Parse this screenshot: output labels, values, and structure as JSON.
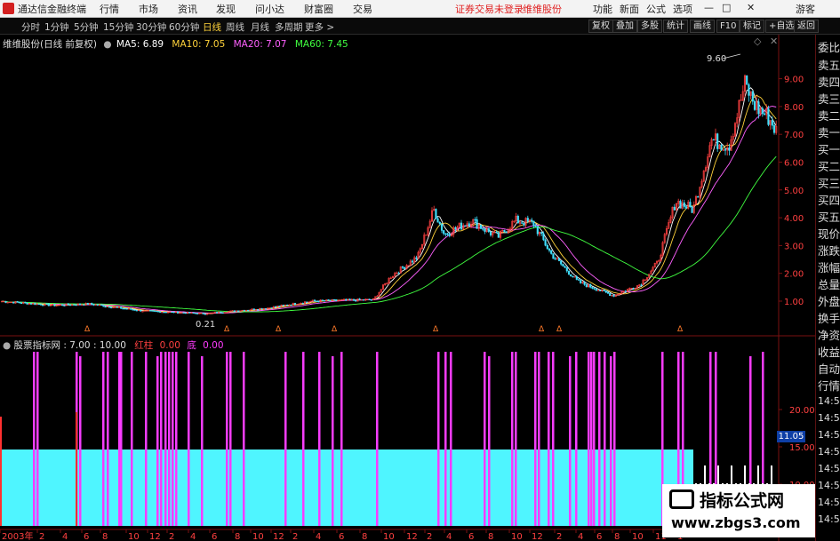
{
  "menubar": {
    "app_title": "通达信金融终端",
    "items": [
      "行情",
      "市场",
      "资讯",
      "发现",
      "问小达",
      "财富圈",
      "交易"
    ],
    "notice": "证券交易未登录",
    "stock_link": "维维股份",
    "right_items": [
      "功能",
      "新面",
      "公式",
      "选项"
    ],
    "user": "游客"
  },
  "tabs": {
    "periods": [
      "分时",
      "1分钟",
      "5分钟",
      "15分钟",
      "30分钟",
      "60分钟",
      "日线",
      "周线",
      "月线",
      "多周期",
      "更多 >"
    ],
    "active_index": 6,
    "tools": [
      "复权",
      "叠加",
      "多股",
      "统计",
      "画线",
      "F10",
      "标记",
      "+自选",
      "返回"
    ]
  },
  "main_chart": {
    "title": "维维股份(日线 前复权)",
    "ma5_label": "MA5: 6.89",
    "ma10_label": "MA10: 7.05",
    "ma20_label": "MA20: 7.07",
    "ma60_label": "MA60: 7.45",
    "max_label": "9.60",
    "min_label": "0.21",
    "y_ticks": [
      "9.00",
      "8.00",
      "7.00",
      "6.00",
      "5.00",
      "4.00",
      "3.00",
      "2.00",
      "1.00"
    ],
    "event_markers": [
      "Δ",
      "Δ",
      "Δ",
      "Δ",
      "Δ",
      "Δ",
      "Δ",
      "Δ"
    ],
    "colors": {
      "up": "#ff4040",
      "down": "#40e0ff",
      "ma5": "#ffffff",
      "ma10": "#ffd23a",
      "ma20": "#ff60ff",
      "ma60": "#40ff40",
      "axis": "#7a1010"
    }
  },
  "indicator": {
    "title": "股票指标网",
    "value_label": ": 7.00 : 10.00",
    "red_label": "红柱",
    "red_value": "0.00",
    "low_label": "底",
    "low_value": "0.00",
    "y_ticks": [
      "20.00",
      "15.00",
      "10.00"
    ],
    "current_value": "11.05",
    "colors": {
      "magenta": "#ff3cff",
      "cyan": "#4ff5ff"
    }
  },
  "x_axis": {
    "labels": [
      "2003年",
      "2",
      "4",
      "6",
      "8",
      "10",
      "12",
      "2",
      "4",
      "6",
      "8",
      "10",
      "12",
      "2",
      "4",
      "6",
      "8",
      "10",
      "12",
      "2",
      "4",
      "6",
      "8",
      "10",
      "12",
      "2",
      "4",
      "6",
      "8",
      "10",
      "11",
      "1"
    ]
  },
  "right_panel": {
    "items": [
      "委比",
      "卖五",
      "卖四",
      "卖三",
      "卖二",
      "卖一",
      "买一",
      "买二",
      "买三",
      "买四",
      "买五",
      "现价",
      "涨跌",
      "涨幅",
      "总量",
      "外盘",
      "换手",
      "净资",
      "收益",
      "自动",
      "行情",
      "14:5",
      "14:5",
      "14:5",
      "14:5",
      "14:5",
      "14:5",
      "14:5",
      "14:5"
    ]
  },
  "watermark": {
    "title": "指标公式网",
    "url": "www.zbgs3.com"
  }
}
